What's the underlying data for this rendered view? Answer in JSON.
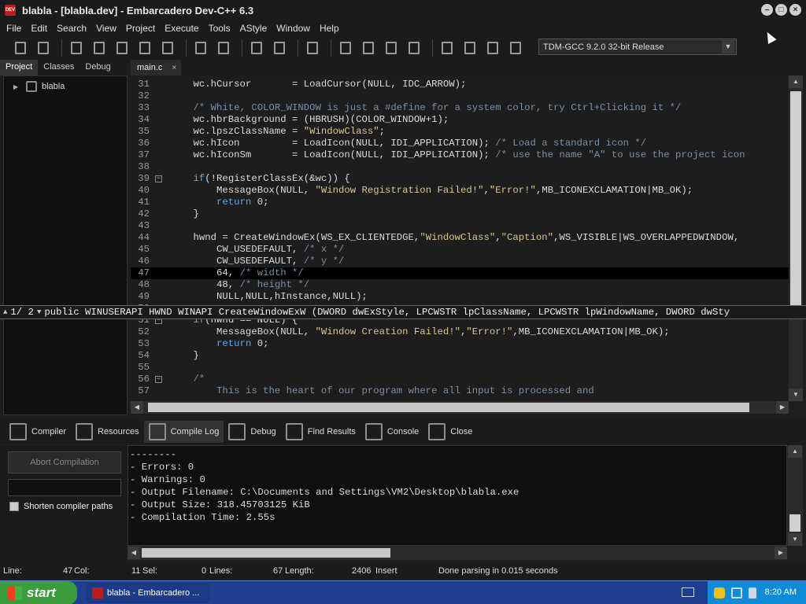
{
  "window": {
    "title": "blabla - [blabla.dev] - Embarcadero Dev-C++ 6.3"
  },
  "menu": [
    "File",
    "Edit",
    "Search",
    "View",
    "Project",
    "Execute",
    "Tools",
    "AStyle",
    "Window",
    "Help"
  ],
  "toolbar": {
    "icons": [
      "new-file-icon",
      "open-file-icon",
      "save-icon",
      "save-all-icon",
      "close-file-icon",
      "close-all-icon",
      "print-icon",
      "undo-icon",
      "redo-icon",
      "indent-icon",
      "unindent-icon",
      "toggle-comment-icon",
      "compile-icon",
      "run-icon",
      "compile-run-icon",
      "rebuild-icon",
      "syntax-check-icon",
      "stop-icon",
      "profile-icon",
      "delete-profile-icon"
    ],
    "compiler": "TDM-GCC 9.2.0 32-bit Release"
  },
  "left_panel": {
    "tabs": [
      "Project",
      "Classes",
      "Debug"
    ],
    "active_tab": "Project",
    "tree_root": "blabla"
  },
  "editor": {
    "tab_label": "main.c",
    "lines": [
      {
        "n": "31",
        "fold": "",
        "html": "    wc.hCursor       = LoadCursor(NULL, IDC_ARROW);"
      },
      {
        "n": "32",
        "fold": "",
        "html": ""
      },
      {
        "n": "33",
        "fold": "",
        "html": "    <span class=\"cmt\">/* White, COLOR_WINDOW is just a #define for a system color, try Ctrl+Clicking it */</span>"
      },
      {
        "n": "34",
        "fold": "",
        "html": "    wc.hbrBackground = (HBRUSH)(COLOR_WINDOW+1);"
      },
      {
        "n": "35",
        "fold": "",
        "html": "    wc.lpszClassName = <span class=\"str\">\"WindowClass\"</span>;"
      },
      {
        "n": "36",
        "fold": "",
        "html": "    wc.hIcon         = LoadIcon(NULL, IDI_APPLICATION); <span class=\"cmt\">/* Load a standard icon */</span>"
      },
      {
        "n": "37",
        "fold": "",
        "html": "    wc.hIconSm       = LoadIcon(NULL, IDI_APPLICATION); <span class=\"cmt\">/* use the name \"A\" to use the project icon</span>"
      },
      {
        "n": "38",
        "fold": "",
        "html": ""
      },
      {
        "n": "39",
        "fold": "−",
        "html": "    <span class=\"kw\">if</span>(!RegisterClassEx(&amp;wc)) {"
      },
      {
        "n": "40",
        "fold": "",
        "html": "        MessageBox(NULL, <span class=\"str\">\"Window Registration Failed!\"</span>,<span class=\"str\">\"Error!\"</span>,MB_ICONEXCLAMATION|MB_OK);"
      },
      {
        "n": "41",
        "fold": "",
        "html": "        <span class=\"kw\">return</span> 0;"
      },
      {
        "n": "42",
        "fold": "",
        "html": "    }"
      },
      {
        "n": "43",
        "fold": "",
        "html": ""
      },
      {
        "n": "44",
        "fold": "",
        "html": "    hwnd = CreateWindowEx(WS_EX_CLIENTEDGE,<span class=\"str\">\"WindowClass\"</span>,<span class=\"str\">\"Caption\"</span>,WS_VISIBLE|WS_OVERLAPPEDWINDOW,"
      },
      {
        "n": "45",
        "fold": "",
        "html": "        CW_USEDEFAULT, <span class=\"cmt\">/* x */</span>"
      },
      {
        "n": "46",
        "fold": "",
        "html": "        CW_USEDEFAULT, <span class=\"cmt\">/* y */</span>"
      },
      {
        "n": "47",
        "fold": "",
        "html": "        64, <span class=\"cmt\">/* width */</span>",
        "current": true
      },
      {
        "n": "48",
        "fold": "",
        "html": "        48, <span class=\"cmt\">/* height */</span>"
      },
      {
        "n": "49",
        "fold": "",
        "html": "        NULL,NULL,hInstance,NULL);"
      },
      {
        "n": "50",
        "fold": "",
        "html": ""
      },
      {
        "n": "51",
        "fold": "−",
        "html": "    <span class=\"kw\">if</span>(hwnd == NULL) {"
      },
      {
        "n": "52",
        "fold": "",
        "html": "        MessageBox(NULL, <span class=\"str\">\"Window Creation Failed!\"</span>,<span class=\"str\">\"Error!\"</span>,MB_ICONEXCLAMATION|MB_OK);"
      },
      {
        "n": "53",
        "fold": "",
        "html": "        <span class=\"kw\">return</span> 0;"
      },
      {
        "n": "54",
        "fold": "",
        "html": "    }"
      },
      {
        "n": "55",
        "fold": "",
        "html": ""
      },
      {
        "n": "56",
        "fold": "−",
        "html": "    <span class=\"cmt\">/*</span>"
      },
      {
        "n": "57",
        "fold": "",
        "html": "        <span class=\"cmt\">This is the heart of our program where all input is processed and</span>"
      }
    ]
  },
  "calltip": {
    "counter": "1/ 2",
    "text": "public WINUSERAPI HWND WINAPI CreateWindowExW (DWORD dwExStyle, LPCWSTR lpClassName, LPCWSTR lpWindowName, DWORD dwSty"
  },
  "bottom_tabs": [
    {
      "label": "Compiler",
      "icon": "compiler-icon",
      "active": false
    },
    {
      "label": "Resources",
      "icon": "resources-icon",
      "active": false
    },
    {
      "label": "Compile Log",
      "icon": "compile-log-icon",
      "active": true
    },
    {
      "label": "Debug",
      "icon": "debug-icon",
      "active": false
    },
    {
      "label": "Find Results",
      "icon": "find-results-icon",
      "active": false
    },
    {
      "label": "Console",
      "icon": "console-icon",
      "active": false
    },
    {
      "label": "Close",
      "icon": "close-icon",
      "active": false
    }
  ],
  "compile_panel": {
    "abort_label": "Abort Compilation",
    "shorten_label": "Shorten compiler paths",
    "log_lines": [
      "--------",
      "- Errors: 0",
      "- Warnings: 0",
      "- Output Filename: C:\\Documents and Settings\\VM2\\Desktop\\blabla.exe",
      "- Output Size: 318.45703125 KiB",
      "- Compilation Time: 2.55s"
    ]
  },
  "statusbar": {
    "line_label": "Line:",
    "line_value": "47",
    "col_label": "Col:",
    "col_value": "11",
    "sel_label": "Sel:",
    "sel_value": "0",
    "lines_label": "Lines:",
    "lines_value": "67",
    "length_label": "Length:",
    "length_value": "2406",
    "mode": "Insert",
    "message": "Done parsing in 0.015 seconds"
  },
  "taskbar": {
    "start_label": "start",
    "task_label": "blabla - Embarcadero ...",
    "clock": "8:20 AM"
  },
  "colors": {
    "start_green": "#3a9c3a",
    "taskbar_blue": "#1f3e8e",
    "tray_blue": "#0f8bd8",
    "app_red": "#b81e1e"
  }
}
